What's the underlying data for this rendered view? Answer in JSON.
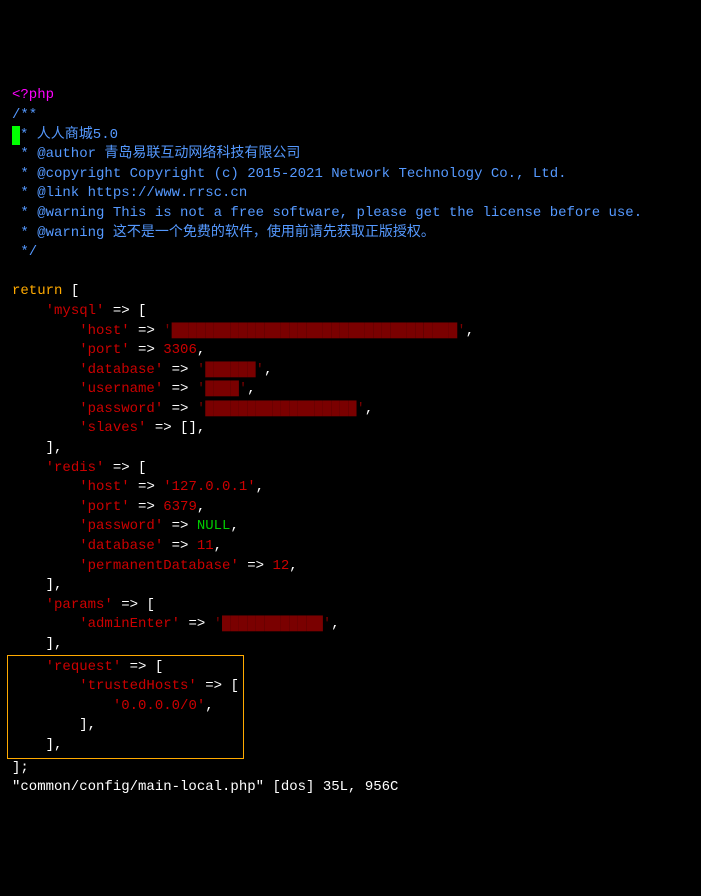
{
  "php_open": "<?php",
  "comment": {
    "open": "/**",
    "line1": "* 人人商城5.0",
    "line2": " * @author 青岛易联互动网络科技有限公司",
    "line3": " * @copyright Copyright (c) 2015-2021 Network Technology Co., Ltd.",
    "line4": " * @link https://www.rrsc.cn",
    "line5": " * @warning This is not a free software, please get the license before use.",
    "line6": " * @warning 这不是一个免费的软件，使用前请先获取正版授权。",
    "close": " */"
  },
  "code": {
    "return": "return",
    "bracket_open": " [",
    "mysql_key": "'mysql'",
    "arrow": " => ",
    "host_key": "'host'",
    "port_key": "'port'",
    "port_val": "3306",
    "database_key": "'database'",
    "username_key": "'username'",
    "password_key": "'password'",
    "slaves_key": "'slaves'",
    "empty_arr": "[]",
    "close_bracket": "],",
    "redis_key": "'redis'",
    "redis_host_val": "'127.0.0.1'",
    "redis_port_val": "6379",
    "null_val": "NULL",
    "redis_db_val": "11",
    "perm_db_key": "'permanentDatabase'",
    "perm_db_val": "12",
    "params_key": "'params'",
    "admin_enter_key": "'adminEnter'",
    "request_key": "'request'",
    "trusted_hosts_key": "'trustedHosts'",
    "trusted_hosts_val": "'0.0.0.0/0'",
    "final_close": "];"
  },
  "status_line": "\"common/config/main-local.php\" [dos] 35L, 956C"
}
